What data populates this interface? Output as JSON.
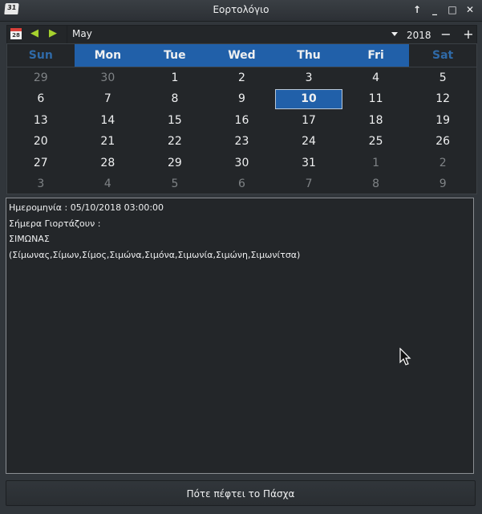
{
  "window": {
    "title": "Εορτολόγιο",
    "app_icon_text": "31",
    "buttons": [
      "keep-above",
      "minimize",
      "maximize",
      "close"
    ]
  },
  "toolbar": {
    "today_icon_text": "28",
    "month": "May",
    "year": "2018",
    "year_minus": "−",
    "year_plus": "+"
  },
  "calendar": {
    "weekdays": [
      "Sun",
      "Mon",
      "Tue",
      "Wed",
      "Thu",
      "Fri",
      "Sat"
    ],
    "selected_day": "10",
    "weeks": [
      [
        {
          "d": "29",
          "o": true
        },
        {
          "d": "30",
          "o": true
        },
        {
          "d": "1"
        },
        {
          "d": "2"
        },
        {
          "d": "3"
        },
        {
          "d": "4"
        },
        {
          "d": "5"
        }
      ],
      [
        {
          "d": "6"
        },
        {
          "d": "7"
        },
        {
          "d": "8"
        },
        {
          "d": "9"
        },
        {
          "d": "10",
          "sel": true
        },
        {
          "d": "11"
        },
        {
          "d": "12"
        }
      ],
      [
        {
          "d": "13"
        },
        {
          "d": "14"
        },
        {
          "d": "15"
        },
        {
          "d": "16"
        },
        {
          "d": "17"
        },
        {
          "d": "18"
        },
        {
          "d": "19"
        }
      ],
      [
        {
          "d": "20"
        },
        {
          "d": "21"
        },
        {
          "d": "22"
        },
        {
          "d": "23"
        },
        {
          "d": "24"
        },
        {
          "d": "25"
        },
        {
          "d": "26"
        }
      ],
      [
        {
          "d": "27"
        },
        {
          "d": "28"
        },
        {
          "d": "29"
        },
        {
          "d": "30"
        },
        {
          "d": "31"
        },
        {
          "d": "1",
          "o": true
        },
        {
          "d": "2",
          "o": true
        }
      ],
      [
        {
          "d": "3",
          "o": true
        },
        {
          "d": "4",
          "o": true
        },
        {
          "d": "5",
          "o": true
        },
        {
          "d": "6",
          "o": true
        },
        {
          "d": "7",
          "o": true
        },
        {
          "d": "8",
          "o": true
        },
        {
          "d": "9",
          "o": true
        }
      ]
    ]
  },
  "info": {
    "lines": [
      "Ημερομηνία : 05/10/2018 03:00:00",
      "Σήμερα Γιορτάζουν :",
      "ΣΙΜΩΝΑΣ",
      "(Σίμωνας,Σίμων,Σίμος,Σιμώνα,Σιμόνα,Σιμωνία,Σιμώνη,Σιμωνίτσα)"
    ]
  },
  "easter_button": "Πότε πέφτει το Πάσχα",
  "colors": {
    "accent": "#2160a9",
    "weekend": "#2f6aa8",
    "background": "#232629"
  }
}
